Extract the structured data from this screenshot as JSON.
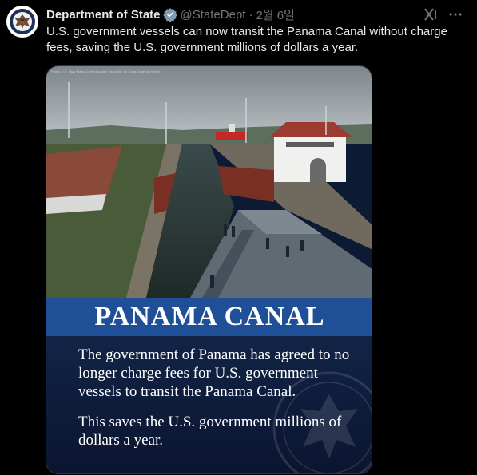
{
  "tweet": {
    "author_name": "Department of State",
    "handle": "@StateDept",
    "separator": "·",
    "date": "2월 6일",
    "text": "U.S. government vessels can now transit the Panama Canal without charge fees, saving the U.S. government millions of dollars a year."
  },
  "media": {
    "credit": "Photo: U.S. Navy Mass Communication Specialist 3rd Class Jonathan Nelson",
    "banner_title": "PANAMA CANAL",
    "paragraph_1": "The government of Panama has agreed to no longer charge fees for U.S. government vessels to transit the Panama Canal.",
    "paragraph_2": "This saves the U.S. government millions of dollars a year."
  },
  "icons": {
    "avatar": "state-department-seal-icon",
    "verified": "verified-badge-icon",
    "grok": "grok-icon",
    "more": "more-options-icon"
  },
  "colors": {
    "background": "#000000",
    "verified_blue": "#829aab",
    "banner_blue": "#1f4f96",
    "card_navy": "#0d1a33"
  }
}
